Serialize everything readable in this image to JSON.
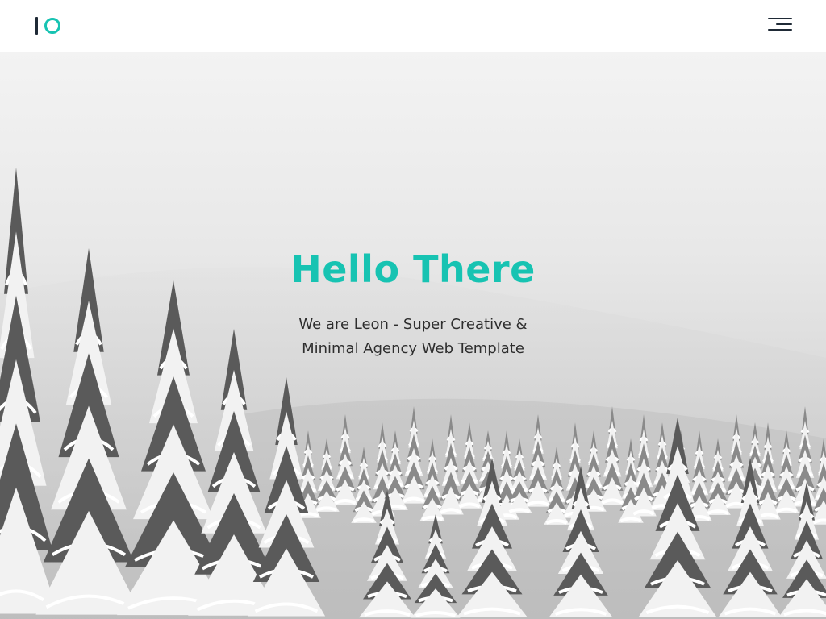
{
  "header": {
    "logo_icon": "io-logo-icon",
    "menu_icon": "hamburger-menu-icon"
  },
  "hero": {
    "title": "Hello There",
    "subtitle_line1": "We are Leon - Super Creative &",
    "subtitle_line2": "Minimal Agency Web Template",
    "background": "snowy-forest-photo"
  },
  "colors": {
    "accent": "#17c3b2",
    "dark": "#1f2a36",
    "text": "#2e2e2e"
  }
}
